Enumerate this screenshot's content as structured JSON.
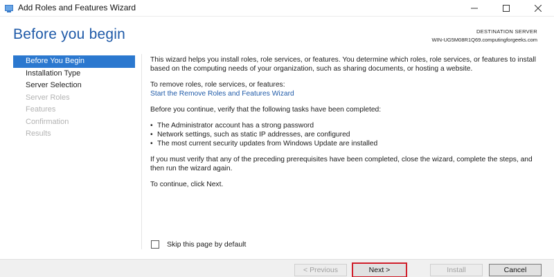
{
  "window": {
    "title": "Add Roles and Features Wizard",
    "icons": {
      "app": "server-manager-icon",
      "minimize": "minimize-icon",
      "maximize": "maximize-icon",
      "close": "close-icon"
    }
  },
  "header": {
    "heading": "Before you begin",
    "destination_label": "DESTINATION SERVER",
    "destination_server": "WIN-UG5M08R1Q69.computingforgeeks.com"
  },
  "nav": {
    "items": [
      {
        "label": "Before You Begin",
        "state": "active"
      },
      {
        "label": "Installation Type",
        "state": "enabled"
      },
      {
        "label": "Server Selection",
        "state": "enabled"
      },
      {
        "label": "Server Roles",
        "state": "disabled"
      },
      {
        "label": "Features",
        "state": "disabled"
      },
      {
        "label": "Confirmation",
        "state": "disabled"
      },
      {
        "label": "Results",
        "state": "disabled"
      }
    ]
  },
  "content": {
    "intro": "This wizard helps you install roles, role services, or features. You determine which roles, role services, or features to install based on the computing needs of your organization, such as sharing documents, or hosting a website.",
    "remove_text": "To remove roles, role services, or features:",
    "remove_link": "Start the Remove Roles and Features Wizard",
    "verify_text": "Before you continue, verify that the following tasks have been completed:",
    "bullets": [
      "The Administrator account has a strong password",
      "Network settings, such as static IP addresses, are configured",
      "The most current security updates from Windows Update are installed"
    ],
    "prereq_text": "If you must verify that any of the preceding prerequisites have been completed, close the wizard, complete the steps, and then run the wizard again.",
    "continue_text": "To continue, click Next."
  },
  "skip": {
    "label": "Skip this page by default",
    "checked": false
  },
  "footer": {
    "previous": "< Previous",
    "next": "Next >",
    "install": "Install",
    "cancel": "Cancel"
  },
  "colors": {
    "heading": "#1f5aa8",
    "nav_active_bg": "#2b78cf",
    "highlight_border": "#d01f2b"
  }
}
